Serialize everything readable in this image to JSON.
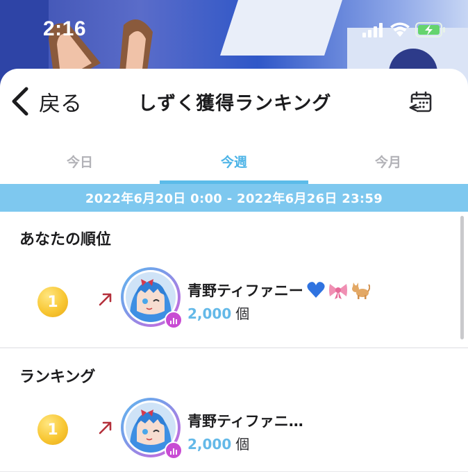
{
  "status_bar": {
    "time": "2:16",
    "icons": [
      "cellular-signal-icon",
      "wifi-icon",
      "battery-charging-icon"
    ],
    "battery_color": "#65d46e"
  },
  "header": {
    "back_label": "戻る",
    "title": "しずく獲得ランキング",
    "calendar_icon": "calendar-swap-icon"
  },
  "tabs": [
    {
      "label": "今日",
      "active": false
    },
    {
      "label": "今週",
      "active": true
    },
    {
      "label": "今月",
      "active": false
    }
  ],
  "date_range": "2022年6月20日 0:00 - 2022年6月26日 23:59",
  "my_rank": {
    "section_title": "あなたの順位",
    "rank": "1",
    "trend_icon": "trend-up-arrow-icon",
    "name": "青野ティファニー",
    "emojis": [
      "blue-heart-icon",
      "ribbon-icon",
      "cat-icon"
    ],
    "amount": "2,000",
    "unit": "個"
  },
  "ranking": {
    "section_title": "ランキング",
    "entries": [
      {
        "rank": "1",
        "trend_icon": "trend-up-arrow-icon",
        "name": "青野ティファニ…",
        "amount": "2,000",
        "unit": "個"
      }
    ]
  },
  "colors": {
    "accent": "#4db4e7",
    "date_band": "#7ec8ef",
    "medal_gold": "#f8c734",
    "trend_arrow": "#b4303b",
    "badge": "#c84bd3"
  }
}
